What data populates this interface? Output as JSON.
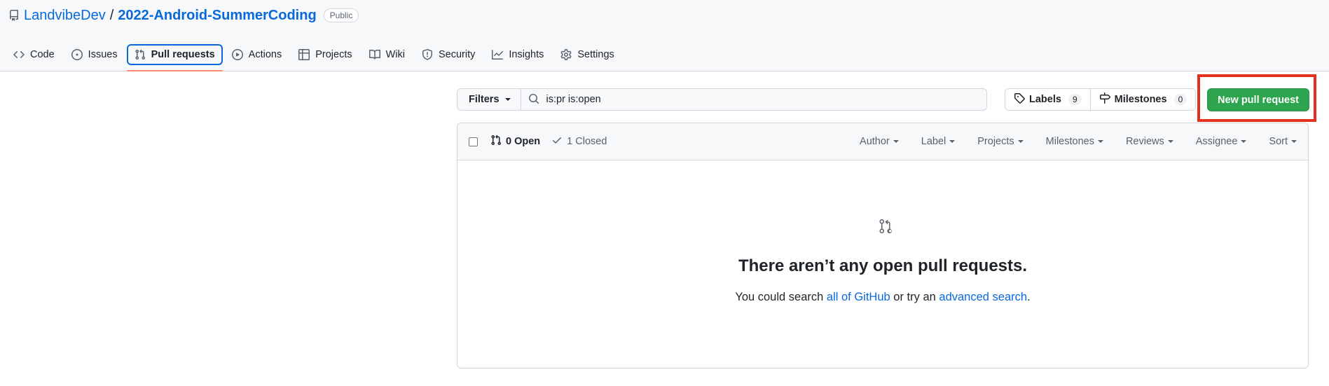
{
  "repo": {
    "owner": "LandvibeDev",
    "separator": "/",
    "name": "2022-Android-SummerCoding",
    "visibility": "Public"
  },
  "nav": {
    "tabs": [
      {
        "label": "Code",
        "icon": "code-icon"
      },
      {
        "label": "Issues",
        "icon": "issue-opened-icon"
      },
      {
        "label": "Pull requests",
        "icon": "git-pull-request-icon",
        "selected": true
      },
      {
        "label": "Actions",
        "icon": "play-icon"
      },
      {
        "label": "Projects",
        "icon": "table-icon"
      },
      {
        "label": "Wiki",
        "icon": "book-icon"
      },
      {
        "label": "Security",
        "icon": "shield-icon"
      },
      {
        "label": "Insights",
        "icon": "graph-icon"
      },
      {
        "label": "Settings",
        "icon": "gear-icon"
      }
    ]
  },
  "subnav": {
    "filters_label": "Filters",
    "search_value": "is:pr is:open",
    "labels_label": "Labels",
    "labels_count": "9",
    "milestones_label": "Milestones",
    "milestones_count": "0",
    "new_pr_label": "New pull request"
  },
  "list_header": {
    "open_label": "0 Open",
    "closed_label": "1 Closed",
    "filters": [
      "Author",
      "Label",
      "Projects",
      "Milestones",
      "Reviews",
      "Assignee",
      "Sort"
    ]
  },
  "blankslate": {
    "title": "There aren’t any open pull requests.",
    "desc_prefix": "You could search ",
    "link1": "all of GitHub",
    "desc_middle": " or try an ",
    "link2": "advanced search",
    "desc_suffix": "."
  },
  "colors": {
    "accent": "#0969da",
    "primary_button": "#2da44e",
    "highlight": "#e4301e",
    "tab_underline": "#fd8c73"
  }
}
